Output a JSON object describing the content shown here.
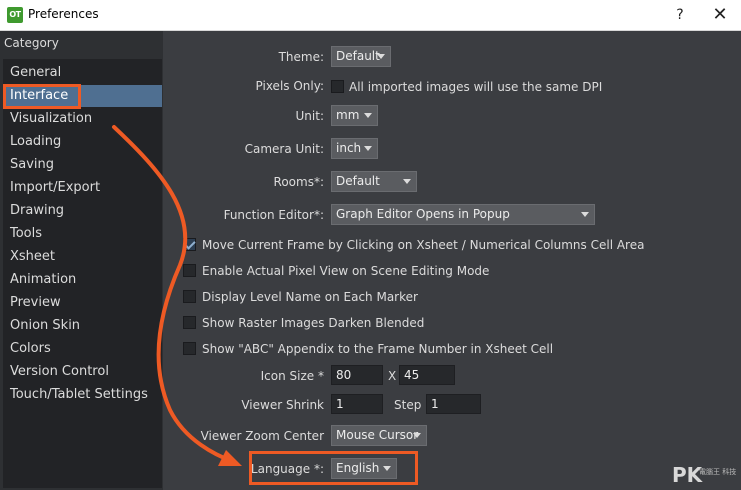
{
  "window": {
    "title": "Preferences",
    "logo_text": "OT",
    "help_glyph": "?",
    "close_glyph": "✕"
  },
  "sidebar": {
    "heading": "Category",
    "items": [
      {
        "label": "General"
      },
      {
        "label": "Interface",
        "selected": true
      },
      {
        "label": "Visualization"
      },
      {
        "label": "Loading"
      },
      {
        "label": "Saving"
      },
      {
        "label": "Import/Export"
      },
      {
        "label": "Drawing"
      },
      {
        "label": "Tools"
      },
      {
        "label": "Xsheet"
      },
      {
        "label": "Animation"
      },
      {
        "label": "Preview"
      },
      {
        "label": "Onion Skin"
      },
      {
        "label": "Colors"
      },
      {
        "label": "Version Control"
      },
      {
        "label": "Touch/Tablet Settings"
      }
    ]
  },
  "interface": {
    "theme": {
      "label": "Theme:",
      "value": "Default"
    },
    "pixels_only": {
      "label": "Pixels Only:",
      "checked": false,
      "text": "All imported images will use the same DPI"
    },
    "unit": {
      "label": "Unit:",
      "value": "mm"
    },
    "camera_unit": {
      "label": "Camera Unit:",
      "value": "inch"
    },
    "rooms": {
      "label": "Rooms*:",
      "value": "Default"
    },
    "function_editor": {
      "label": "Function Editor*:",
      "value": "Graph Editor Opens in Popup"
    },
    "checkboxes": [
      {
        "text": "Move Current Frame by Clicking on Xsheet / Numerical Columns Cell Area",
        "checked": true
      },
      {
        "text": "Enable Actual Pixel View on Scene Editing Mode",
        "checked": false
      },
      {
        "text": "Display Level Name on Each Marker",
        "checked": false
      },
      {
        "text": "Show Raster Images Darken Blended",
        "checked": false
      },
      {
        "text": "Show \"ABC\" Appendix to the Frame Number in Xsheet Cell",
        "checked": false
      }
    ],
    "icon_size": {
      "label": "Icon Size *",
      "width": "80",
      "separator": "X",
      "height": "45"
    },
    "viewer_shrink": {
      "label": "Viewer  Shrink",
      "value": "1",
      "step_label": "Step",
      "step_value": "1"
    },
    "viewer_zoom_center": {
      "label": "Viewer Zoom Center",
      "value": "Mouse Cursor"
    },
    "language": {
      "label": "Language *:",
      "value": "English"
    }
  },
  "annotation": {
    "color": "#ee5a24"
  },
  "watermark": {
    "text": "PK",
    "subtext": "電腦王 科技"
  }
}
